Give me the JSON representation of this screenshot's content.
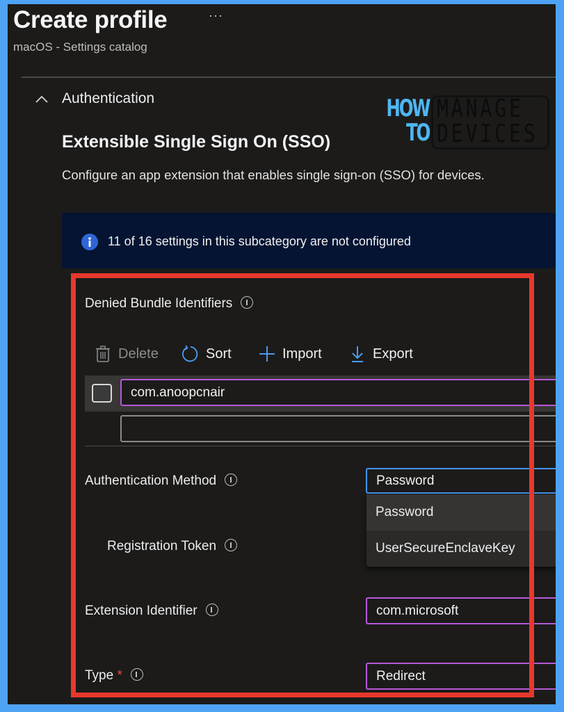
{
  "header": {
    "title": "Create profile",
    "more_label": "···",
    "subtitle": "macOS - Settings catalog"
  },
  "section": {
    "label": "Authentication",
    "expanded": true
  },
  "logo": {
    "line1": "HOW",
    "line2": "TO",
    "brand_line1": "MANAGE",
    "brand_line2": "DEVICES",
    "accent_color": "#4eb6f0"
  },
  "subcategory": {
    "title": "Extensible Single Sign On (SSO)",
    "description": "Configure an app extension that enables single sign-on (SSO) for devices."
  },
  "banner": {
    "text": "11 of 16 settings in this subcategory are not configured",
    "configured_not": 11,
    "total": 16
  },
  "denied_bundle": {
    "label": "Denied Bundle Identifiers",
    "toolbar": {
      "delete": "Delete",
      "sort": "Sort",
      "import": "Import",
      "export": "Export"
    },
    "rows": [
      {
        "value": "com.anoopcnair",
        "checked": false
      },
      {
        "value": "",
        "placeholder": ""
      }
    ]
  },
  "auth_method": {
    "label": "Authentication Method",
    "value": "Password",
    "options": [
      "Password",
      "UserSecureEnclaveKey"
    ]
  },
  "registration_token": {
    "label": "Registration Token"
  },
  "extension_identifier": {
    "label": "Extension Identifier",
    "value": "com.microsoft"
  },
  "type": {
    "label": "Type",
    "required_mark": "*",
    "value": "Redirect"
  },
  "colors": {
    "panel_bg": "#1c1b1a",
    "frame": "#4fa3f5",
    "highlight_box": "#e8382c",
    "input_border": "#b659d9",
    "focus_border": "#4493ee",
    "banner_bg": "#041432"
  }
}
